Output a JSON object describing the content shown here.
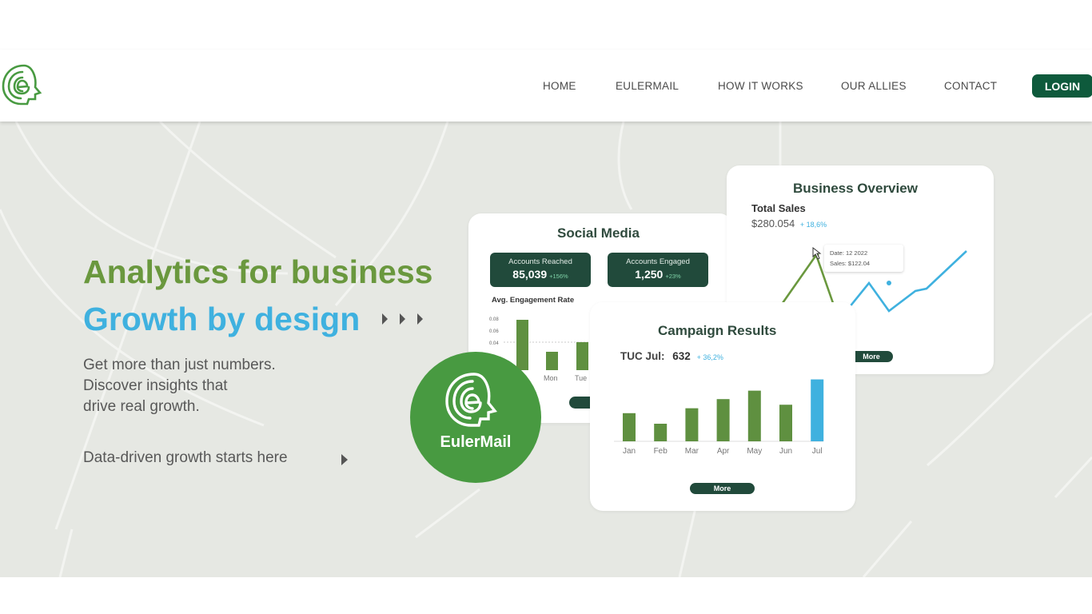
{
  "nav": {
    "items": [
      "HOME",
      "EULERMAIL",
      "HOW IT WORKS",
      "OUR ALLIES",
      "CONTACT"
    ],
    "login_label": "LOGIN"
  },
  "hero": {
    "headline_1": "Analytics for business",
    "headline_2": "Growth by design",
    "subtext_lines": [
      "Get more than just numbers.",
      "Discover insights that",
      "drive real growth."
    ],
    "cta": "Data-driven growth starts here"
  },
  "badge": {
    "label": "EulerMail"
  },
  "social_media": {
    "title": "Social Media",
    "stats": [
      {
        "label": "Accounts Reached",
        "value": "85,039",
        "delta": "+156%"
      },
      {
        "label": "Accounts Engaged",
        "value": "1,250",
        "delta": "+23%"
      }
    ],
    "engagement_title": "Avg. Engagement Rate",
    "y_ticks": [
      "0.08",
      "0.06",
      "0.04"
    ],
    "x_labels": [
      "Mon",
      "Tue"
    ]
  },
  "business_overview": {
    "title": "Business Overview",
    "total_label": "Total Sales",
    "total_value": "$280.054",
    "total_delta": "+ 18,6%",
    "tooltip_date": "Date:  12 2022",
    "tooltip_sales": "Sales: $122.04",
    "more_label": "More"
  },
  "campaign": {
    "title": "Campaign Results",
    "tuc_label": "TUC Jul:",
    "tuc_value": "632",
    "tuc_delta": "+ 36,2%",
    "more_label": "More"
  },
  "colors": {
    "green": "#6a983e",
    "blue": "#3fb1df",
    "dark_green": "#214a3b",
    "bar_green": "#5f9040",
    "badge_green": "#489a41"
  },
  "chart_data": [
    {
      "type": "bar",
      "title": "Campaign Results",
      "categories": [
        "Jan",
        "Feb",
        "Mar",
        "Apr",
        "May",
        "Jun",
        "Jul"
      ],
      "values": [
        40,
        25,
        47,
        60,
        72,
        52,
        88
      ],
      "highlight": "Jul"
    },
    {
      "type": "bar",
      "title": "Avg. Engagement Rate",
      "y_ticks": [
        "0.08",
        "0.06",
        "0.04"
      ],
      "values": [
        0.082,
        0.045,
        0.05
      ]
    },
    {
      "type": "line",
      "title": "Total Sales",
      "series": [
        {
          "color": "#6a983e",
          "values": [
            30,
            90,
            30
          ]
        },
        {
          "color": "#3fb1df",
          "values": [
            60,
            20,
            45,
            48,
            95
          ]
        }
      ]
    }
  ]
}
